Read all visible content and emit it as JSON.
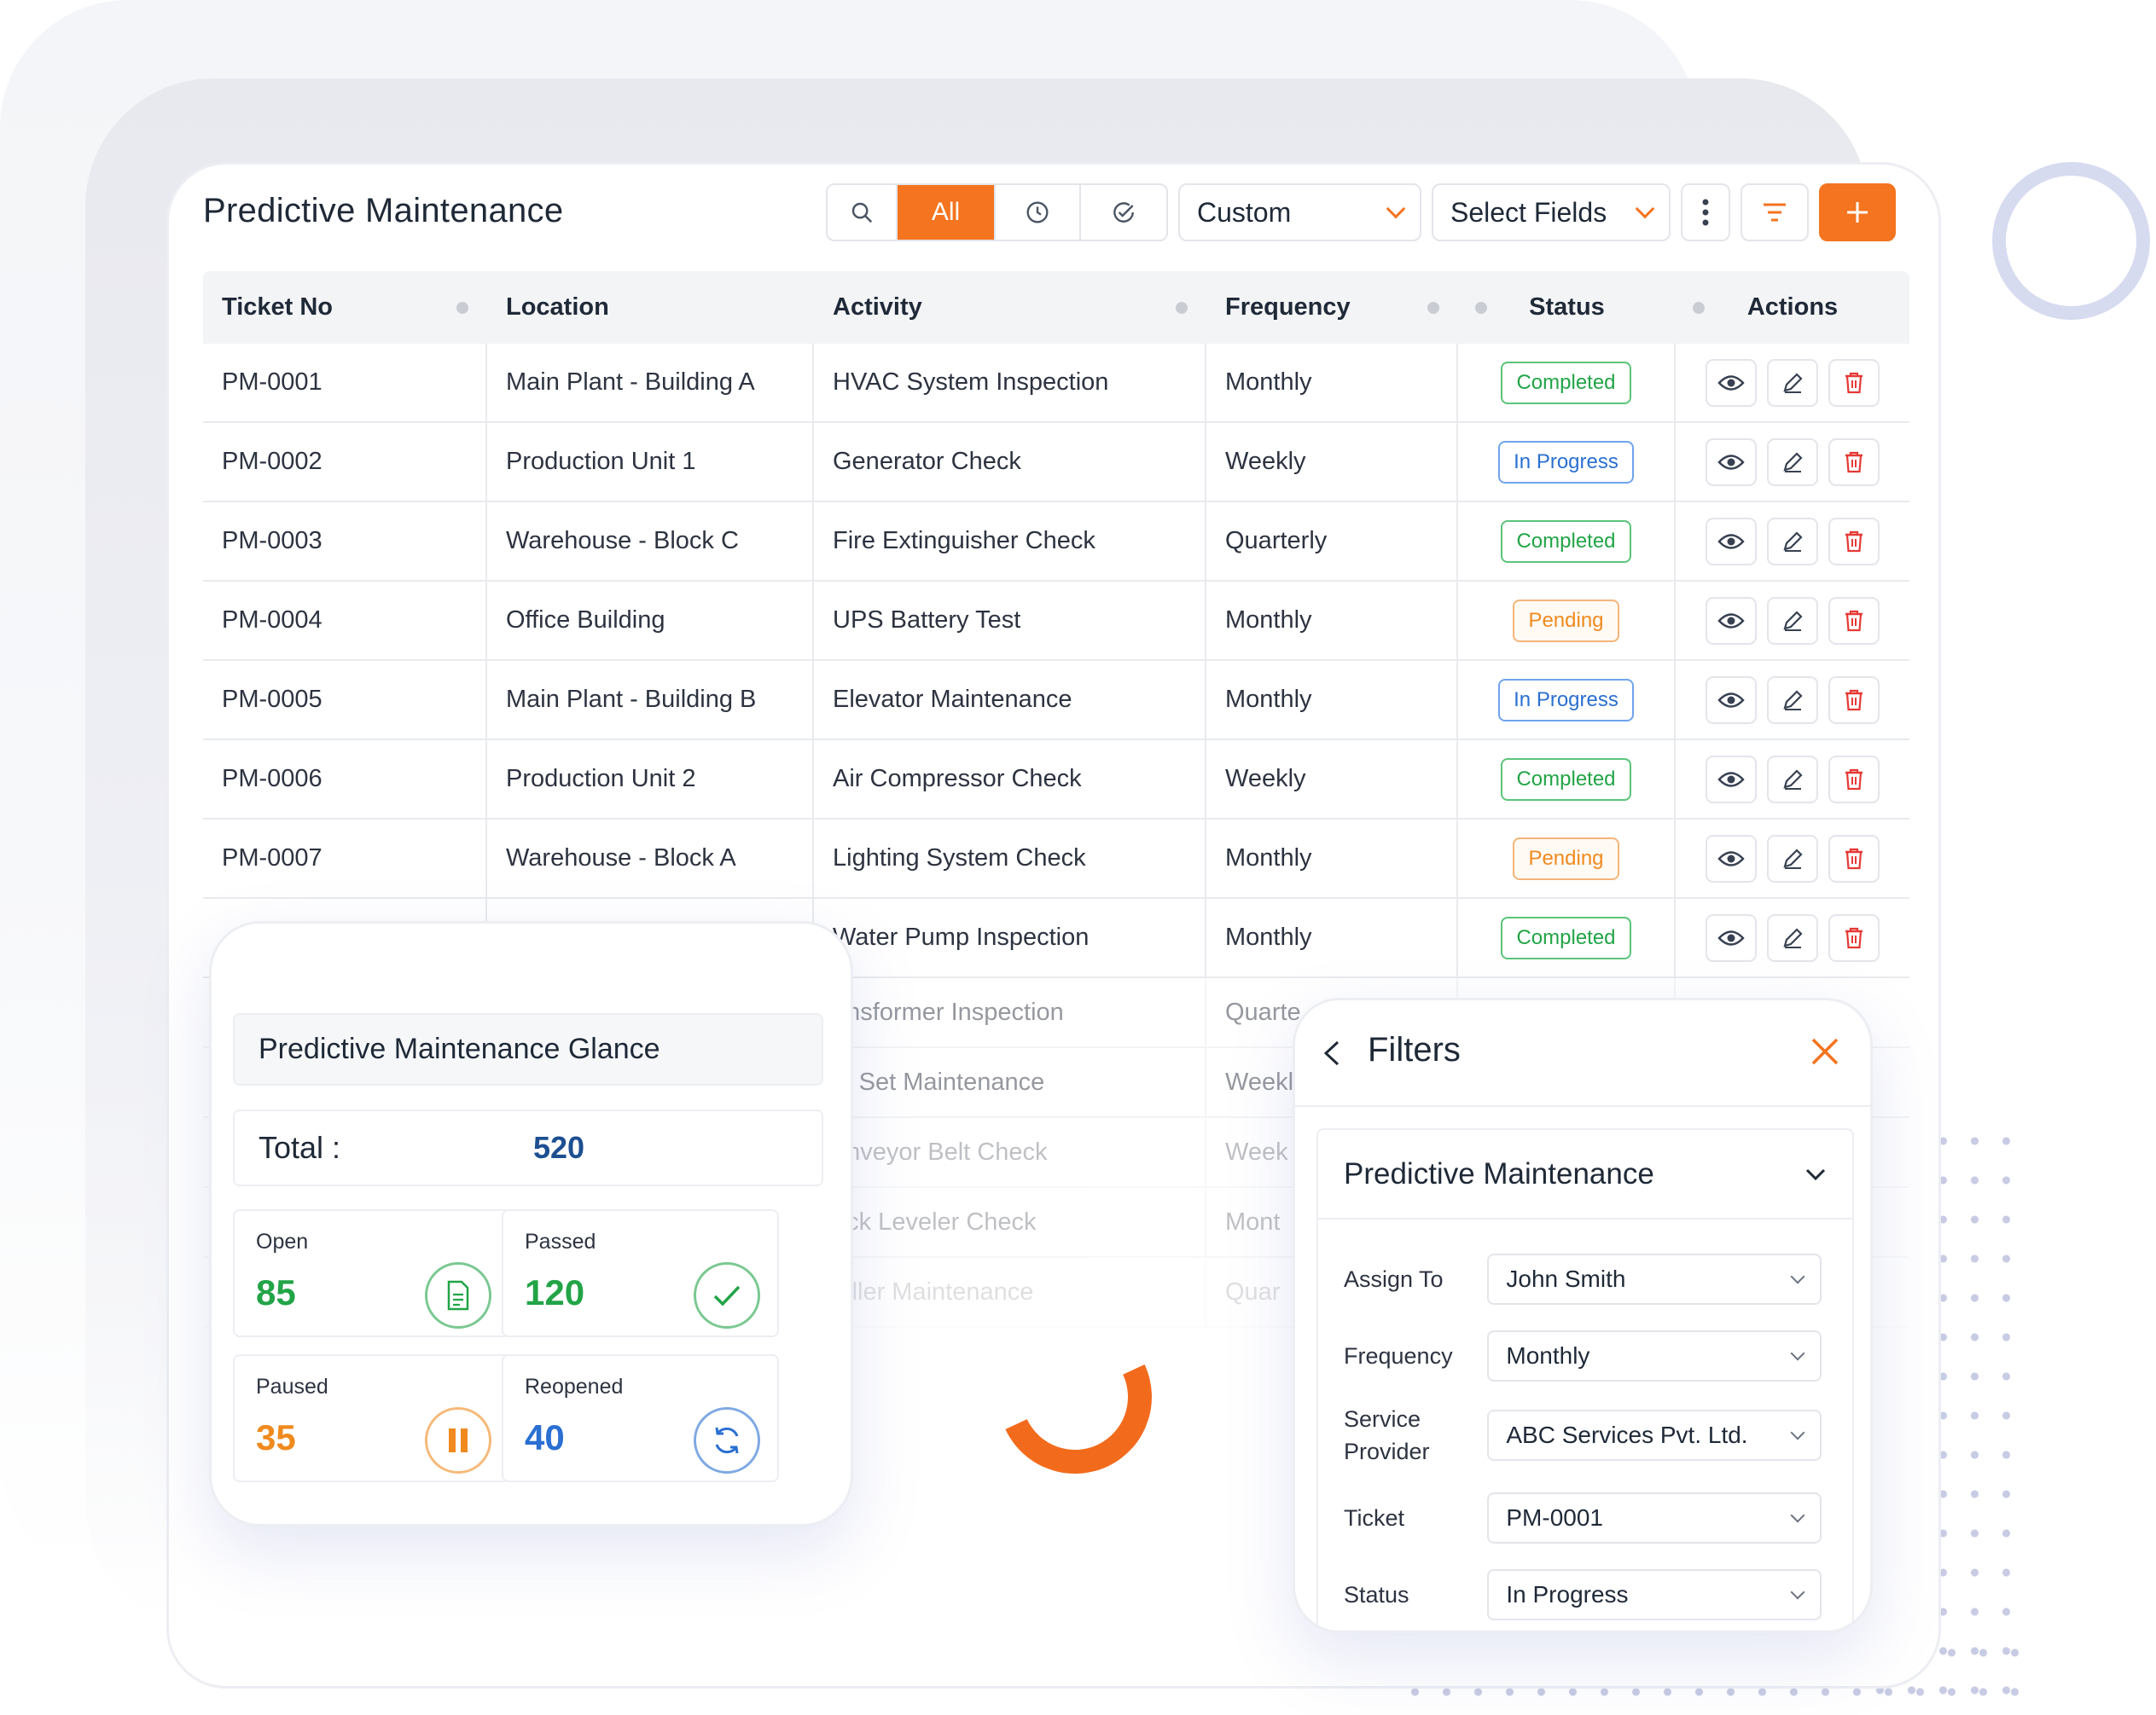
{
  "header": {
    "title": "Predictive Maintenance",
    "filter_all_label": "All",
    "custom_dropdown": "Custom",
    "select_fields_dropdown": "Select Fields"
  },
  "colors": {
    "accent": "#f4741f",
    "completed": "#22a447",
    "in_progress": "#2a6fd1",
    "pending": "#f08a1f"
  },
  "table": {
    "columns": [
      "Ticket No",
      "Location",
      "Activity",
      "Frequency",
      "Status",
      "Actions"
    ],
    "rows": [
      {
        "ticket": "PM-0001",
        "location": "Main Plant - Building A",
        "activity": "HVAC System Inspection",
        "frequency": "Monthly",
        "status": "Completed"
      },
      {
        "ticket": "PM-0002",
        "location": "Production Unit 1",
        "activity": "Generator Check",
        "frequency": "Weekly",
        "status": "In Progress"
      },
      {
        "ticket": "PM-0003",
        "location": "Warehouse - Block C",
        "activity": "Fire Extinguisher Check",
        "frequency": "Quarterly",
        "status": "Completed"
      },
      {
        "ticket": "PM-0004",
        "location": "Office Building",
        "activity": "UPS Battery Test",
        "frequency": "Monthly",
        "status": "Pending"
      },
      {
        "ticket": "PM-0005",
        "location": "Main Plant - Building B",
        "activity": "Elevator Maintenance",
        "frequency": "Monthly",
        "status": "In Progress"
      },
      {
        "ticket": "PM-0006",
        "location": "Production Unit 2",
        "activity": "Air Compressor Check",
        "frequency": "Weekly",
        "status": "Completed"
      },
      {
        "ticket": "PM-0007",
        "location": "Warehouse - Block A",
        "activity": "Lighting System Check",
        "frequency": "Monthly",
        "status": "Pending"
      },
      {
        "ticket": "",
        "location": "",
        "activity": "Water Pump Inspection",
        "frequency": "Monthly",
        "status": "Completed"
      },
      {
        "ticket": "",
        "location": "",
        "activity": "ansformer Inspection",
        "frequency": "Quarte",
        "status": ""
      },
      {
        "ticket": "",
        "location": "",
        "activity": "G Set Maintenance",
        "frequency": "Weekl",
        "status": ""
      },
      {
        "ticket": "",
        "location": "",
        "activity": "onveyor Belt Check",
        "frequency": "Week",
        "status": ""
      },
      {
        "ticket": "",
        "location": "",
        "activity": "ock Leveler Check",
        "frequency": "Mont",
        "status": ""
      },
      {
        "ticket": "",
        "location": "",
        "activity": "hiller Maintenance",
        "frequency": "Quar",
        "status": ""
      }
    ]
  },
  "glance": {
    "title": "Predictive Maintenance Glance",
    "total_label": "Total :",
    "total_value": "520",
    "stats": [
      {
        "label": "Open",
        "value": "85",
        "color": "#22a447",
        "icon": "document-icon"
      },
      {
        "label": "Passed",
        "value": "120",
        "color": "#22a447",
        "icon": "check-icon"
      },
      {
        "label": "Paused",
        "value": "35",
        "color": "#f08a1f",
        "icon": "pause-icon"
      },
      {
        "label": "Reopened",
        "value": "40",
        "color": "#2a6fd1",
        "icon": "refresh-icon"
      }
    ]
  },
  "filters": {
    "title": "Filters",
    "section": "Predictive Maintenance",
    "fields": [
      {
        "label": "Assign To",
        "value": "John Smith"
      },
      {
        "label": "Frequency",
        "value": "Monthly"
      },
      {
        "label": "Service Provider",
        "value": "ABC Services Pvt. Ltd."
      },
      {
        "label": "Ticket",
        "value": "PM-0001"
      },
      {
        "label": "Status",
        "value": "In Progress"
      }
    ]
  }
}
